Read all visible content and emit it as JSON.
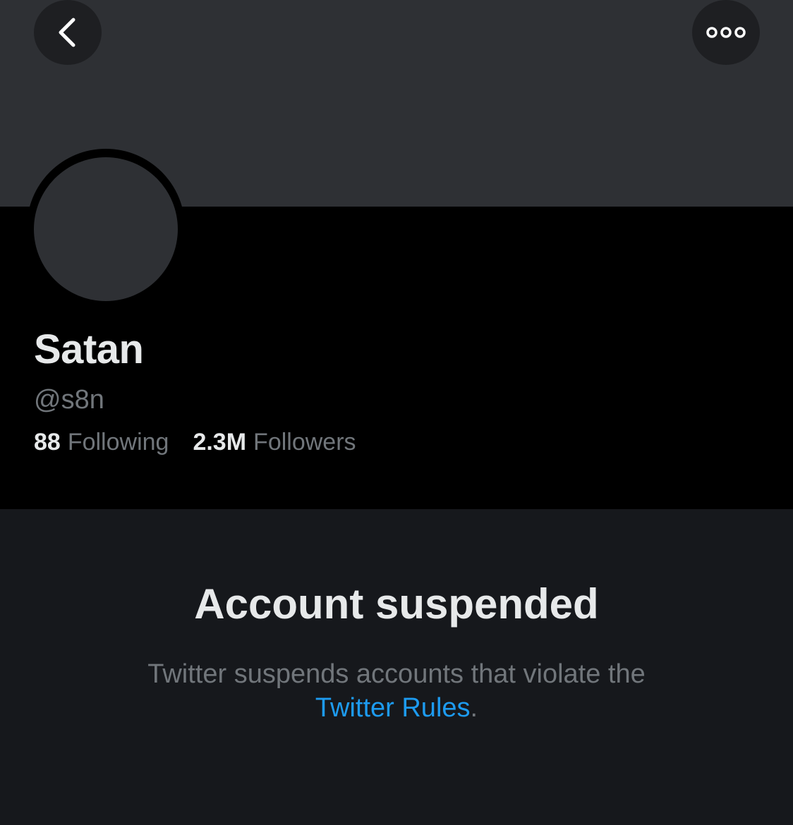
{
  "header": {
    "back_icon": "chevron-left-icon",
    "more_icon": "ellipsis-icon"
  },
  "profile": {
    "name": "Satan",
    "handle": "@s8n",
    "following_count": "88",
    "following_label": "Following",
    "followers_count": "2.3M",
    "followers_label": "Followers"
  },
  "suspension": {
    "title": "Account suspended",
    "message_line1": "Twitter suspends accounts that violate the",
    "link_text": "Twitter Rules",
    "trailing": "."
  },
  "colors": {
    "banner": "#2e3034",
    "background": "#000000",
    "link": "#1d9bf0",
    "muted_text": "#71767b",
    "primary_text": "#e7e9ea"
  }
}
